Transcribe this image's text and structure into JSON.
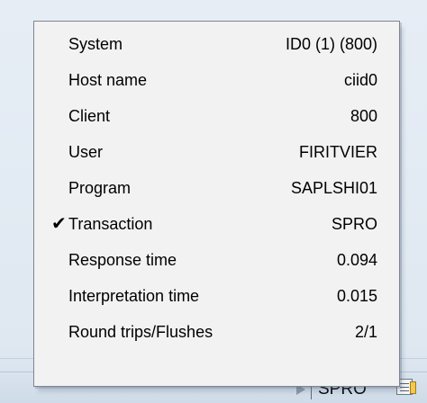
{
  "status_bar": {
    "transaction": "SPRO"
  },
  "menu": {
    "items": [
      {
        "label": "System",
        "value": "ID0 (1) (800)",
        "checked": false
      },
      {
        "label": "Host name",
        "value": "ciid0",
        "checked": false
      },
      {
        "label": "Client",
        "value": "800",
        "checked": false
      },
      {
        "label": "User",
        "value": "FIRITVIER",
        "checked": false
      },
      {
        "label": "Program",
        "value": "SAPLSHI01",
        "checked": false
      },
      {
        "label": "Transaction",
        "value": "SPRO",
        "checked": true,
        "check_icon": "checkmark-icon"
      },
      {
        "label": "Response time",
        "value": "0.094",
        "checked": false
      },
      {
        "label": "Interpretation time",
        "value": "0.015",
        "checked": false
      },
      {
        "label": "Round trips/Flushes",
        "value": "2/1",
        "checked": false
      }
    ]
  }
}
